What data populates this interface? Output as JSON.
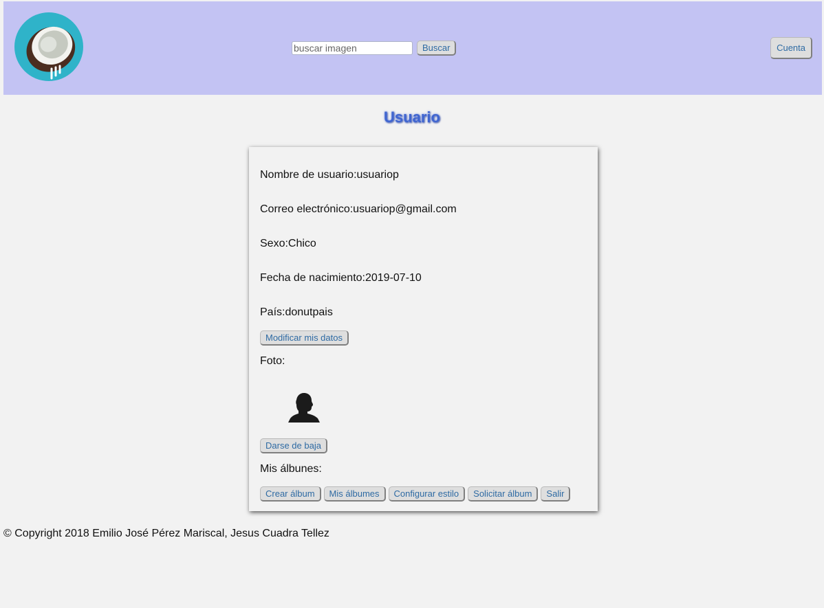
{
  "header": {
    "logo_icon": "coconut-logo-icon",
    "search": {
      "placeholder": "buscar imagen",
      "value": "",
      "button_label": "Buscar"
    },
    "account_button_label": "Cuenta"
  },
  "page_title": "Usuario",
  "profile": {
    "username": "Nombre de usuario:usuariop",
    "email": "Correo electrónico:usuariop@gmail.com",
    "sex": "Sexo:Chico",
    "birthdate": "Fecha de nacimiento:2019-07-10",
    "country": "País:donutpais",
    "edit_button_label": "Modificar mis datos",
    "photo_label": "Foto:",
    "photo_icon": "user-silhouette-icon",
    "unsubscribe_button_label": "Darse de baja",
    "albums_label": "Mis álbunes:",
    "album_buttons": [
      "Crear álbum",
      "Mis álbumes",
      "Configurar estilo",
      "Solicitar álbum",
      "Salir"
    ]
  },
  "footer": "© Copyright 2018 Emilio José Pérez Mariscal, Jesus Cuadra Tellez",
  "colors": {
    "header_bg": "#c3c3f3",
    "title": "#3f65d0",
    "button_text": "#2e6aa3",
    "page_bg": "#f2f2f2"
  }
}
